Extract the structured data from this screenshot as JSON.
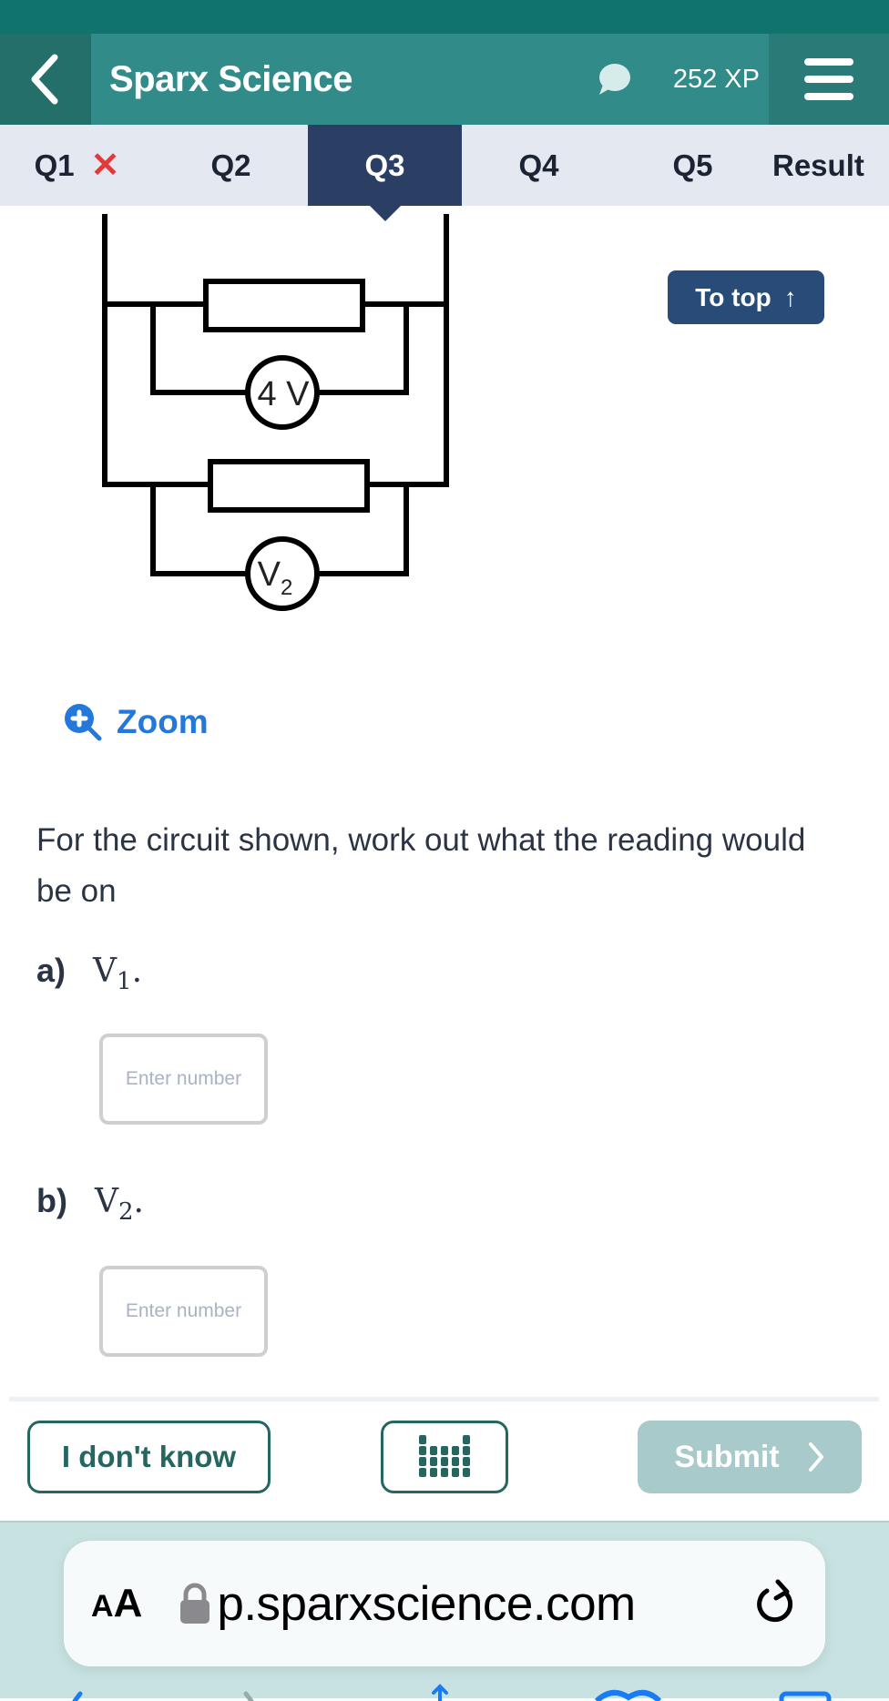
{
  "header": {
    "title": "Sparx Science",
    "xp": "252 XP",
    "icons": {
      "back": "chevron-left-icon",
      "chat": "chat-bubble-icon",
      "menu": "hamburger-menu-icon"
    }
  },
  "tabs": [
    {
      "label": "Q1",
      "status": "incorrect",
      "status_icon": "✕"
    },
    {
      "label": "Q2"
    },
    {
      "label": "Q3",
      "active": true
    },
    {
      "label": "Q4"
    },
    {
      "label": "Q5"
    },
    {
      "label": "Result"
    }
  ],
  "diagram": {
    "voltmeter_top_label": "4 V",
    "voltmeter_bottom_label": "V",
    "voltmeter_bottom_subscript": "2"
  },
  "to_top": {
    "label": "To top",
    "icon": "↑"
  },
  "zoom": {
    "label": "Zoom"
  },
  "question": {
    "text": "For the circuit shown, work out what the reading would be on",
    "parts": [
      {
        "letter": "a)",
        "var": "V",
        "sub": "1",
        "suffix": ".",
        "placeholder": "Enter number",
        "value": ""
      },
      {
        "letter": "b)",
        "var": "V",
        "sub": "2",
        "suffix": ".",
        "placeholder": "Enter number",
        "value": ""
      }
    ]
  },
  "actions": {
    "dont_know": "I don't know",
    "periodic_table_icon": "periodic-table-icon",
    "submit": "Submit",
    "submit_chevron": "›"
  },
  "browser": {
    "aa_small": "A",
    "aa_large": "A",
    "url": "p.sparxscience.com"
  },
  "colors": {
    "header": "#318b88",
    "status_strip": "#11746c",
    "active_tab": "#2a3f63",
    "accent_blue": "#2578db",
    "incorrect": "#e03b3b",
    "teal_dark": "#256660",
    "submit_disabled": "#a9cacb"
  }
}
